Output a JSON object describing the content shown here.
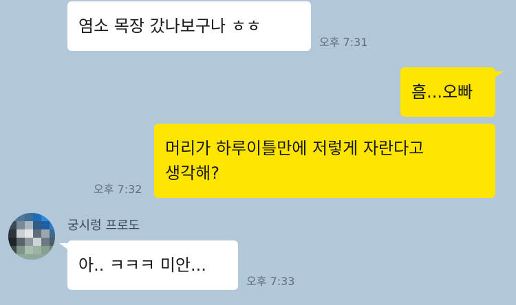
{
  "messages": [
    {
      "sender": "other",
      "text": "염소 목장 갔나보구나 ㅎㅎ",
      "time": "오후 7:31"
    },
    {
      "sender": "me",
      "text": "흠...오빠"
    },
    {
      "sender": "me",
      "line1": "머리가 하루이틀만에 저렇게 자란다고",
      "line2": "생각해?",
      "time": "오후 7:32"
    },
    {
      "sender": "other",
      "name": "궁시렁 프로도",
      "text": "아.. ㅋㅋㅋ 미안...",
      "time": "오후 7:33"
    }
  ],
  "colors": {
    "background": "#b2c7d9",
    "outgoing_bubble": "#fee500",
    "incoming_bubble": "#ffffff"
  },
  "avatar": {
    "icon": "pixelated-profile-avatar"
  }
}
